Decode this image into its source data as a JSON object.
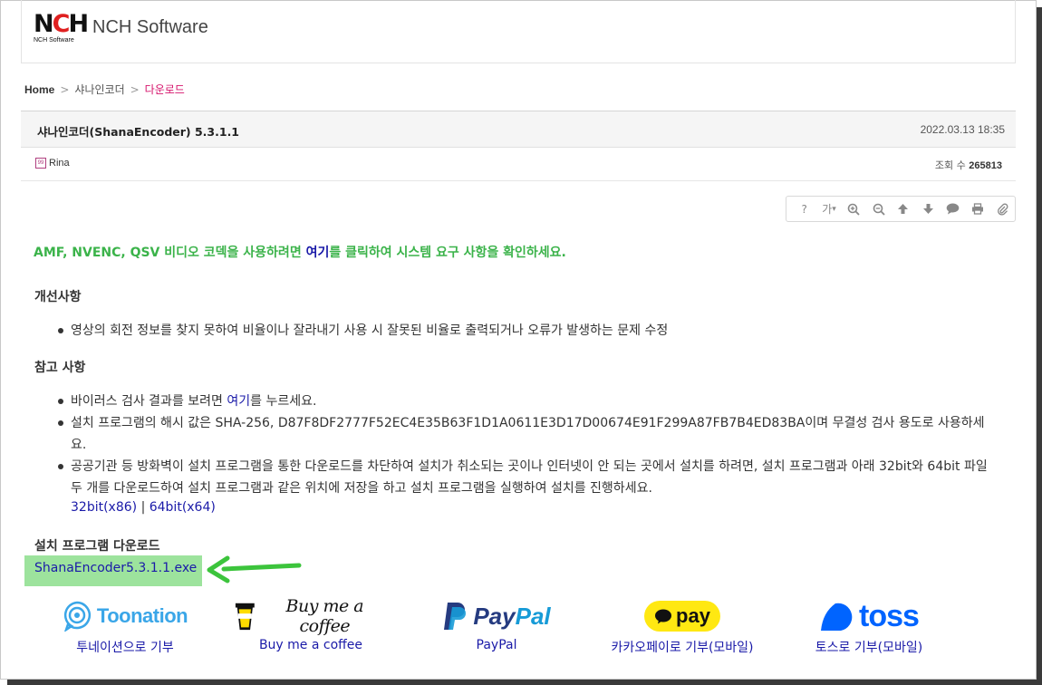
{
  "header": {
    "logo_mark_n": "N",
    "logo_mark_c": "C",
    "logo_mark_h": "H",
    "logo_sub": "NCH Software",
    "site_name": "NCH Software"
  },
  "breadcrumb": {
    "home": "Home",
    "sep": ">",
    "category": "샤나인코더",
    "current": "다운로드"
  },
  "post": {
    "title": "샤나인코더(ShanaEncoder) 5.3.1.1",
    "date": "2022.03.13 18:35",
    "author": "Rina",
    "author_badge": "99",
    "views_label": "조회 수",
    "views": "265813"
  },
  "toolbar": {
    "help": "?",
    "font": "가",
    "font_caret": "▾",
    "zoom_in": "+",
    "zoom_out": "−"
  },
  "notice": {
    "prefix": "AMF, NVENC, QSV 비디오 코덱을 사용하려면 ",
    "link": "여기",
    "suffix": "를 클릭하여 시스템 요구 사항을 확인하세요."
  },
  "improvements": {
    "heading": "개선사항",
    "items": [
      "영상의 회전 정보를 찾지 못하여 비율이나 잘라내기 사용 시 잘못된 비율로 출력되거나 오류가 발생하는 문제 수정"
    ]
  },
  "notes": {
    "heading": "참고 사항",
    "item1_prefix": "바이러스 검사 결과를 보려면 ",
    "item1_link": "여기",
    "item1_suffix": "를 누르세요.",
    "item2": "설치 프로그램의 해시 값은 SHA-256, D87F8DF2777F52EC4E35B63F1D1A0611E3D17D00674E91F299A87FB7B4ED83BA이며 무결성 검사 용도로 사용하세요.",
    "item3": "공공기관 등 방화벽이 설치 프로그램을 통한 다운로드를 차단하여 설치가 취소되는 곳이나 인터넷이 안 되는 곳에서 설치를 하려면, 설치 프로그램과 아래 32bit와 64bit 파일 두 개를 다운로드하여 설치 프로그램과 같은 위치에 저장을 하고 설치 프로그램을 실행하여 설치를 진행하세요.",
    "link32": "32bit(x86)",
    "divider": "|",
    "link64": "64bit(x64)"
  },
  "download": {
    "heading": "설치 프로그램 다운로드",
    "file": "ShanaEncoder5.3.1.1.exe"
  },
  "donations": [
    {
      "brand": "Toonation",
      "label": "투네이션으로 기부"
    },
    {
      "brand": "Buy me a coffee",
      "label": "Buy me a coffee"
    },
    {
      "brand_a": "Pay",
      "brand_b": "Pal",
      "label": "PayPal"
    },
    {
      "brand": "pay",
      "label": "카카오페이로 기부(모바일)"
    },
    {
      "brand": "toss",
      "label": "토스로 기부(모바일)"
    }
  ],
  "colors": {
    "notice_green": "#3bb34a",
    "link_blue": "#1a1aa8",
    "breadcrumb_current": "#d6146c",
    "highlight": "#9de39d",
    "arrow": "#3cc43c"
  }
}
